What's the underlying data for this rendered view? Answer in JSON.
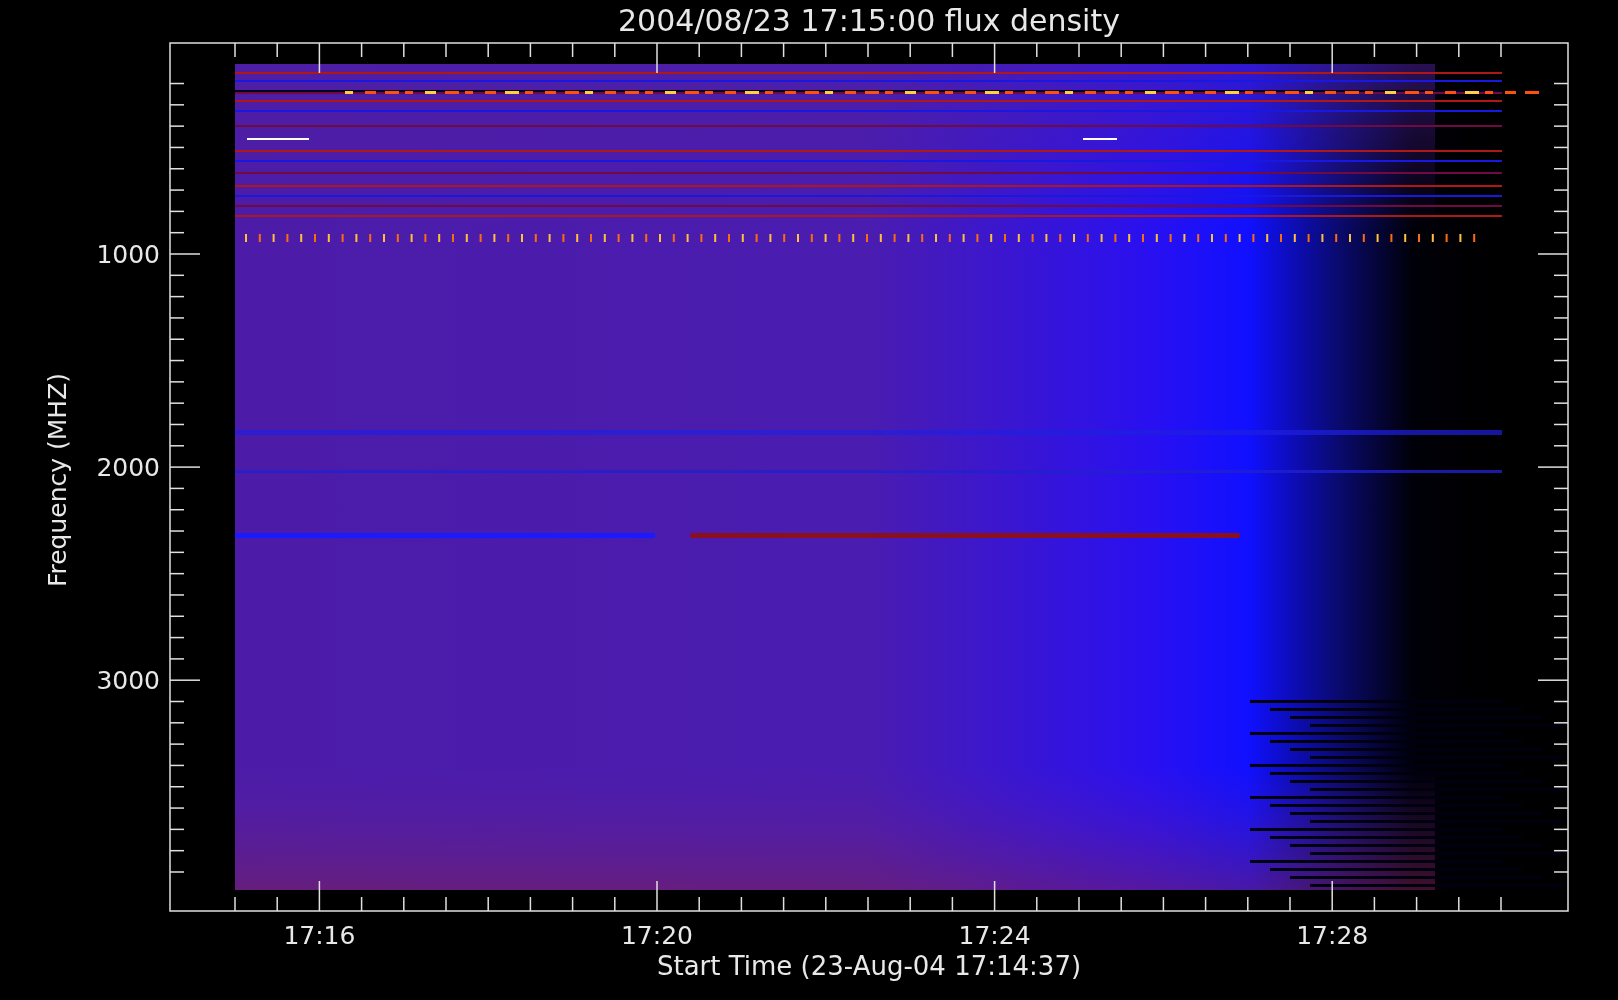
{
  "title": "2004/08/23 17:15:00 flux density",
  "plot": {
    "ylabel": "Frequency (MHZ)",
    "xlabel": "Start Time (23-Aug-04 17:14:37)",
    "yticks": [
      "1000",
      "2000",
      "3000"
    ],
    "xticks": [
      "17:16",
      "17:20",
      "17:24",
      "17:28"
    ]
  }
}
